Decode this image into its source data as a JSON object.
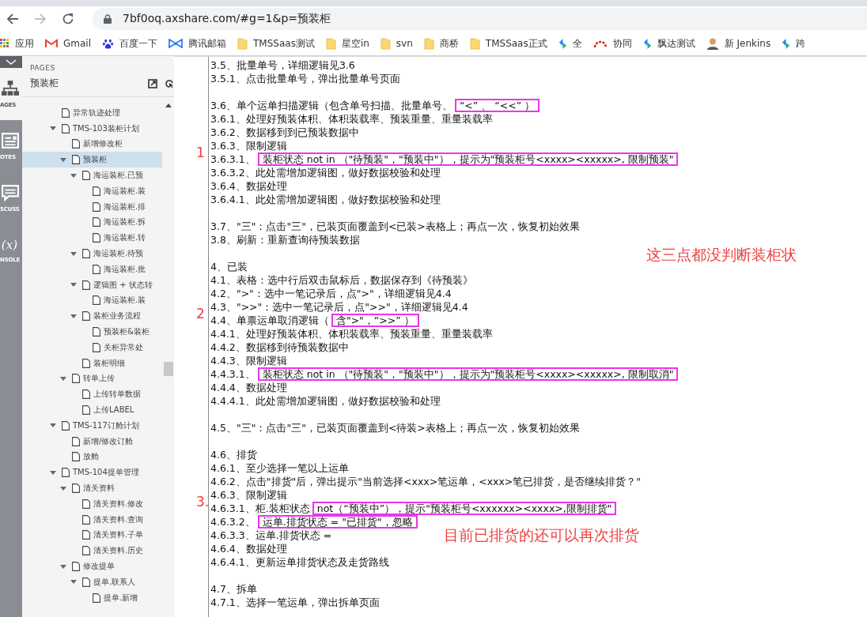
{
  "browser": {
    "url": "7bf0oq.axshare.com/#g=1&p=预装柜"
  },
  "bookmarks": [
    {
      "label": "应用",
      "kind": "apps"
    },
    {
      "label": "Gmail",
      "kind": "gmail"
    },
    {
      "label": "百度一下",
      "kind": "paw"
    },
    {
      "label": "腾讯邮箱",
      "kind": "bowtie"
    },
    {
      "label": "TMSSaas测试",
      "kind": "folder"
    },
    {
      "label": "星空in",
      "kind": "folder"
    },
    {
      "label": "svn",
      "kind": "folder"
    },
    {
      "label": "商桥",
      "kind": "folder"
    },
    {
      "label": "TMSSaas正式",
      "kind": "folder"
    },
    {
      "label": "全",
      "kind": "diamond"
    },
    {
      "label": "协同",
      "kind": "arc"
    },
    {
      "label": "飘达测试",
      "kind": "diamond"
    },
    {
      "label": "新 Jenkins",
      "kind": "avatar"
    },
    {
      "label": "跨",
      "kind": "diamond"
    }
  ],
  "rail": [
    {
      "label": "AGES",
      "kind": "sitemap",
      "selected": true
    },
    {
      "label": "OTES",
      "kind": "notes",
      "selected": false
    },
    {
      "label": "SCUSS",
      "kind": "discuss",
      "selected": false
    },
    {
      "label": "NSOLE",
      "kind": "console",
      "glyph": "(x)",
      "selected": false
    }
  ],
  "sidebar": {
    "heading": "PAGES",
    "title": "预装柜",
    "tree": [
      {
        "label": "异常轨迹处理",
        "selected": false
      },
      {
        "label": "TMS-103装柜计划",
        "expanded": true,
        "selected": false,
        "children": [
          {
            "label": "新增修改柜",
            "selected": false
          },
          {
            "label": "预装柜",
            "expanded": true,
            "selected": true,
            "children": [
              {
                "label": "海运装柜.已预",
                "expanded": true,
                "selected": false,
                "children": [
                  {
                    "label": "海运装柜.装",
                    "selected": false
                  },
                  {
                    "label": "海运装柜.排",
                    "selected": false
                  },
                  {
                    "label": "海运装柜.拆",
                    "selected": false
                  },
                  {
                    "label": "海运装柜.转",
                    "selected": false
                  }
                ]
              },
              {
                "label": "海运装柜.待预",
                "expanded": true,
                "selected": false,
                "children": [
                  {
                    "label": "海运装柜.批",
                    "selected": false
                  }
                ]
              },
              {
                "label": "逻辑图 + 状态转",
                "expanded": true,
                "selected": false,
                "children": [
                  {
                    "label": "海运装柜.装",
                    "selected": false
                  }
                ]
              },
              {
                "label": "装柜业务流程",
                "expanded": true,
                "selected": false,
                "children": [
                  {
                    "label": "预装柜&装柜",
                    "selected": false
                  },
                  {
                    "label": "关柜异常处",
                    "selected": false
                  }
                ]
              },
              {
                "label": "装柜明细",
                "selected": false
              }
            ]
          },
          {
            "label": "转单上传",
            "expanded": true,
            "selected": false,
            "children": [
              {
                "label": "上传转单数据",
                "selected": false
              },
              {
                "label": "上传LABEL",
                "selected": false
              }
            ]
          }
        ]
      },
      {
        "label": "TMS-117订舱计划",
        "expanded": true,
        "selected": false,
        "children": [
          {
            "label": "新增/修改订舱",
            "selected": false
          },
          {
            "label": "放舱",
            "selected": false
          }
        ]
      },
      {
        "label": "TMS-104提单管理",
        "expanded": true,
        "selected": false,
        "children": [
          {
            "label": "清关资料",
            "expanded": true,
            "selected": false,
            "children": [
              {
                "label": "清关资料.修改",
                "selected": false
              },
              {
                "label": "清关资料.查询",
                "selected": false
              },
              {
                "label": "清关资料.子单",
                "selected": false
              },
              {
                "label": "清关资料.历史",
                "selected": false
              }
            ]
          },
          {
            "label": "修改提单",
            "expanded": true,
            "selected": false,
            "children": [
              {
                "label": "提单.联系人",
                "expanded": true,
                "selected": false,
                "children": [
                  {
                    "label": "提单.新增",
                    "selected": false
                  }
                ]
              }
            ]
          }
        ]
      }
    ]
  },
  "document": {
    "sections": [
      {
        "lines": [
          {
            "text": "3.5、批量单号，详细逻辑见3.6"
          },
          {
            "text": "3.5.1、点击批量单号，弹出批量单号页面"
          }
        ]
      },
      {
        "lines": [
          {
            "parts": [
              {
                "text": "3.6、单个运单扫描逻辑（包含单号扫描、批量单号、",
                "boxed": false
              },
              {
                "text": "“<” 、 “<<” ）",
                "boxed": true
              }
            ]
          },
          {
            "text": "3.6.1、处理好预装体积、体积装载率、预装重量、重量装载率"
          },
          {
            "text": "3.6.2、数据移到到已预装数据中"
          },
          {
            "text": "3.6.3、限制逻辑"
          },
          {
            "marker": "1",
            "parts": [
              {
                "text": "3.6.3.1、",
                "boxed": false
              },
              {
                "text": "装柜状态 not in （\"待预装\"，\"预装中\"），提示为\"预装柜号<xxxx><xxxxx>, 限制预装\"",
                "boxed": true
              }
            ]
          },
          {
            "text": "3.6.3.2、此处需增加逻辑图，做好数据校验和处理"
          },
          {
            "text": "3.6.4、数据处理"
          },
          {
            "text": "3.6.4.1、此处需增加逻辑图，做好数据校验和处理"
          }
        ]
      },
      {
        "lines": [
          {
            "text": "3.7、\"三\"：点击\"三\"，已装页面覆盖到<已装>表格上；再点一次，恢复初始效果"
          },
          {
            "text": "3.8、刷新：重新查询待预装数据"
          }
        ]
      },
      {
        "lines": [
          {
            "text": "4、已装"
          },
          {
            "text": "4.1、表格：选中行后双击鼠标后，数据保存到《待预装》"
          },
          {
            "text": "4.2、\">\"：选中一笔记录后，点\">\"，详细逻辑见4.4"
          },
          {
            "text": "4.3、\">>\"：选中一笔记录后，点\">>\"，详细逻辑见4.4"
          },
          {
            "marker": "2",
            "parts": [
              {
                "text": "4.4、单票运单取消逻辑（",
                "boxed": false
              },
              {
                "text": "含\">\"，“>>” ）",
                "boxed": true
              }
            ]
          },
          {
            "text": "4.4.1、处理好预装体积、体积装载率、预装重量、重量装载率"
          },
          {
            "text": "4.4.2、数据移到待预装数据中"
          },
          {
            "text": "4.4.3、限制逻辑"
          },
          {
            "parts": [
              {
                "text": "4.4.3.1、",
                "boxed": false
              },
              {
                "text": "装柜状态 not in （\"待预装\"，\"预装中\"），提示为\"预装柜号<xxxx><xxxxx>, 限制取消\"",
                "boxed": true
              }
            ]
          },
          {
            "text": "4.4.4、数据处理"
          },
          {
            "text": "4.4.4.1、此处需增加逻辑图，做好数据校验和处理"
          }
        ]
      },
      {
        "lines": [
          {
            "text": "4.5、\"三\"：点击\"三\"，已装页面覆盖到<待装>表格上；再点一次，恢复初始效果"
          }
        ]
      },
      {
        "lines": [
          {
            "text": "4.6、排货"
          },
          {
            "text": "4.6.1、至少选择一笔以上运单"
          },
          {
            "text": "4.6.2、点击\"排货\"后，弹出提示\"当前选择<xxx>笔运单，<xxx>笔已排货，是否继续排货？\""
          },
          {
            "text": "4.6.3、限制逻辑"
          },
          {
            "marker": "3.",
            "parts": [
              {
                "text": "4.6.3.1、柜.装柜状态",
                "boxed": false
              },
              {
                "text": "not（“预装中”），提示\"预装柜号<xxxxxx><xxxx>,限制排货\"",
                "boxed": true
              }
            ]
          },
          {
            "parts": [
              {
                "text": "4.6.3.2、",
                "boxed": false
              },
              {
                "text": "运单.排货状态 = \"已排货\"，忽略",
                "boxed": true
              }
            ]
          },
          {
            "text": "4.6.3.3、运单.排货状态 ="
          },
          {
            "text": "4.6.4、数据处理"
          },
          {
            "text": "4.6.4.1、更新运单排货状态及走货路线"
          }
        ]
      },
      {
        "lines": [
          {
            "text": "4.7、拆单"
          },
          {
            "text": "4.7.1、选择一笔运单，弹出拆单页面"
          }
        ]
      }
    ],
    "notes": [
      {
        "text": "这三点都没判断装柜状"
      },
      {
        "text": "目前已排货的还可以再次排货"
      }
    ]
  }
}
